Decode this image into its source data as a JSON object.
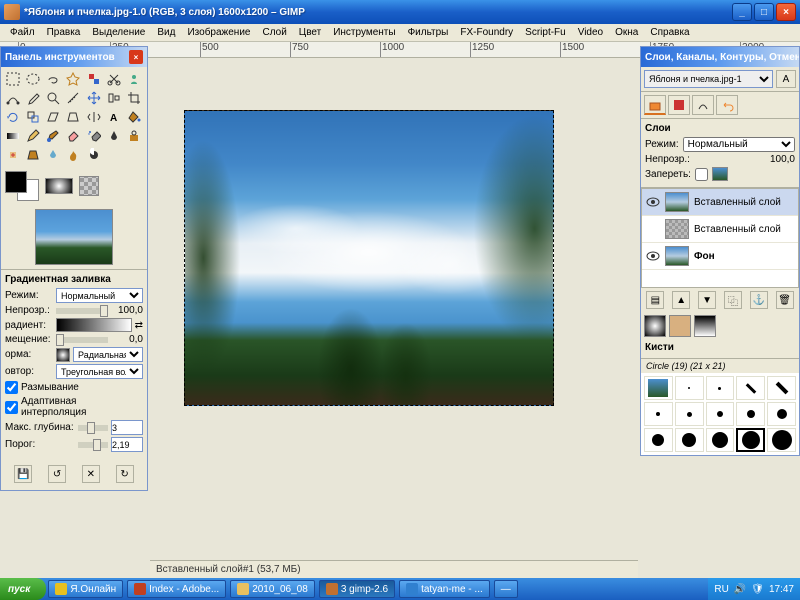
{
  "window": {
    "title": "*Яблоня и пчелка.jpg-1.0 (RGB, 3 слоя) 1600x1200 – GIMP"
  },
  "menu": {
    "items": [
      "Файл",
      "Правка",
      "Выделение",
      "Вид",
      "Изображение",
      "Слой",
      "Цвет",
      "Инструменты",
      "Фильтры",
      "FX-Foundry",
      "Script-Fu",
      "Video",
      "Окна",
      "Справка"
    ]
  },
  "ruler_ticks": [
    "0",
    "250",
    "500",
    "750",
    "1000",
    "1250",
    "1500",
    "1750",
    "2000"
  ],
  "toolbox": {
    "title": "Панель инструментов",
    "options_title": "Градиентная заливка",
    "mode_label": "Режим:",
    "mode_value": "Нормальный",
    "opacity_label": "Непрозр.:",
    "opacity_value": "100,0",
    "gradient_label": "радиент:",
    "offset_label": "мещение:",
    "offset_value": "0,0",
    "shape_label": "орма:",
    "shape_value": "Радиальная",
    "repeat_label": "овтор:",
    "repeat_value": "Треугольная волна",
    "dither_label": "Размывание",
    "adaptive_label": "Адаптивная интерполяция",
    "maxdepth_label": "Макс. глубина:",
    "maxdepth_value": "3",
    "threshold_label": "Порог:",
    "threshold_value": "2,19"
  },
  "canvas": {
    "status": "Вставленный слой#1 (53,7 МБ)"
  },
  "rightdock": {
    "title": "Слои, Каналы, Контуры, Отмена...",
    "selector": "Яблоня и пчелка.jpg-1",
    "auto": "А",
    "layers_head": "Слои",
    "mode_label": "Режим:",
    "mode_value": "Нормальный",
    "opacity_label": "Непрозр.:",
    "opacity_value": "100,0",
    "lock_label": "Запереть:",
    "layers": [
      {
        "name": "Вставленный слой",
        "vis": true,
        "thumb": "sky"
      },
      {
        "name": "Вставленный слой",
        "vis": false,
        "thumb": "tex"
      },
      {
        "name": "Фон",
        "vis": true,
        "thumb": "sky"
      }
    ],
    "brushes_head": "Кисти",
    "brush_label": "Circle (19) (21 x 21)"
  },
  "taskbar": {
    "start": "пуск",
    "items": [
      "Я.Онлайн",
      "Index - Adobe...",
      "2010_06_08",
      "3 gimp-2.6",
      "tatyan-me - ...",
      "—"
    ],
    "lang": "RU",
    "time": "17:47"
  }
}
